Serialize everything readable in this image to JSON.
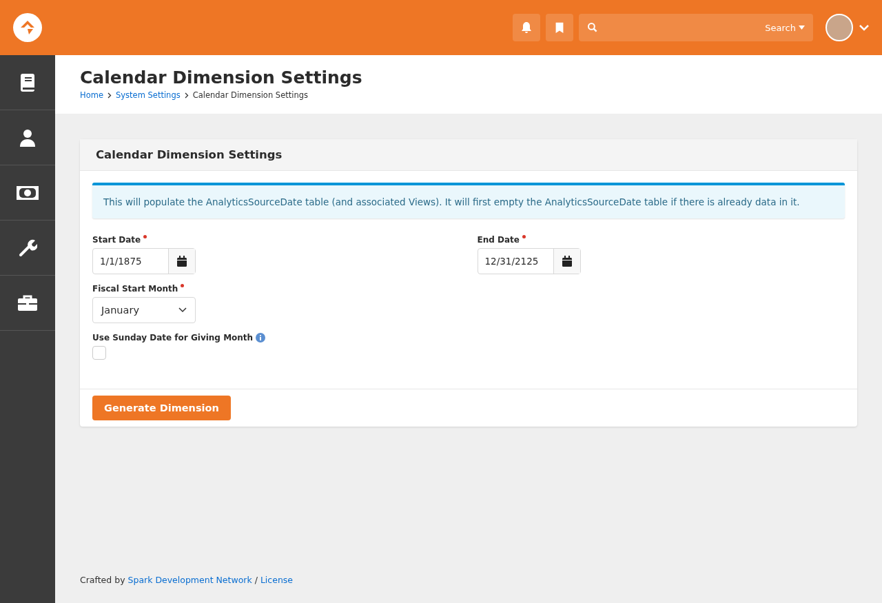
{
  "header": {
    "search": {
      "button": "Search"
    }
  },
  "sidebar": {
    "items": [
      {
        "kind": "book",
        "selected": false
      },
      {
        "kind": "person",
        "selected": false
      },
      {
        "kind": "money",
        "selected": false
      },
      {
        "kind": "wrench",
        "selected": false
      },
      {
        "kind": "briefcase",
        "selected": false
      }
    ]
  },
  "page": {
    "title": "Calendar Dimension Settings",
    "breadcrumbs": [
      "Home",
      "System Settings",
      "Calendar Dimension Settings"
    ]
  },
  "panel": {
    "title": "Calendar Dimension Settings",
    "alert": "This will populate the AnalyticsSourceDate table (and associated Views). It will first empty the AnalyticsSourceDate table if there is already data in it.",
    "field_rows": [
      [
        {
          "kind": "date",
          "label": "Start Date",
          "required": true,
          "help": false,
          "value": "1/1/1875"
        },
        {
          "kind": "date",
          "label": "End Date",
          "required": true,
          "help": false,
          "value": "12/31/2125"
        }
      ],
      [
        {
          "kind": "select",
          "label": "Fiscal Start Month",
          "required": true,
          "help": false,
          "value": "January"
        }
      ],
      [
        {
          "kind": "checkbox",
          "label": "Use Sunday Date for Giving Month",
          "required": false,
          "help": true,
          "checked": false
        }
      ]
    ],
    "button": "Generate Dimension"
  },
  "footer": {
    "prefix": "Crafted by",
    "link": "Spark Development Network",
    "separator": "/",
    "license": "License"
  }
}
